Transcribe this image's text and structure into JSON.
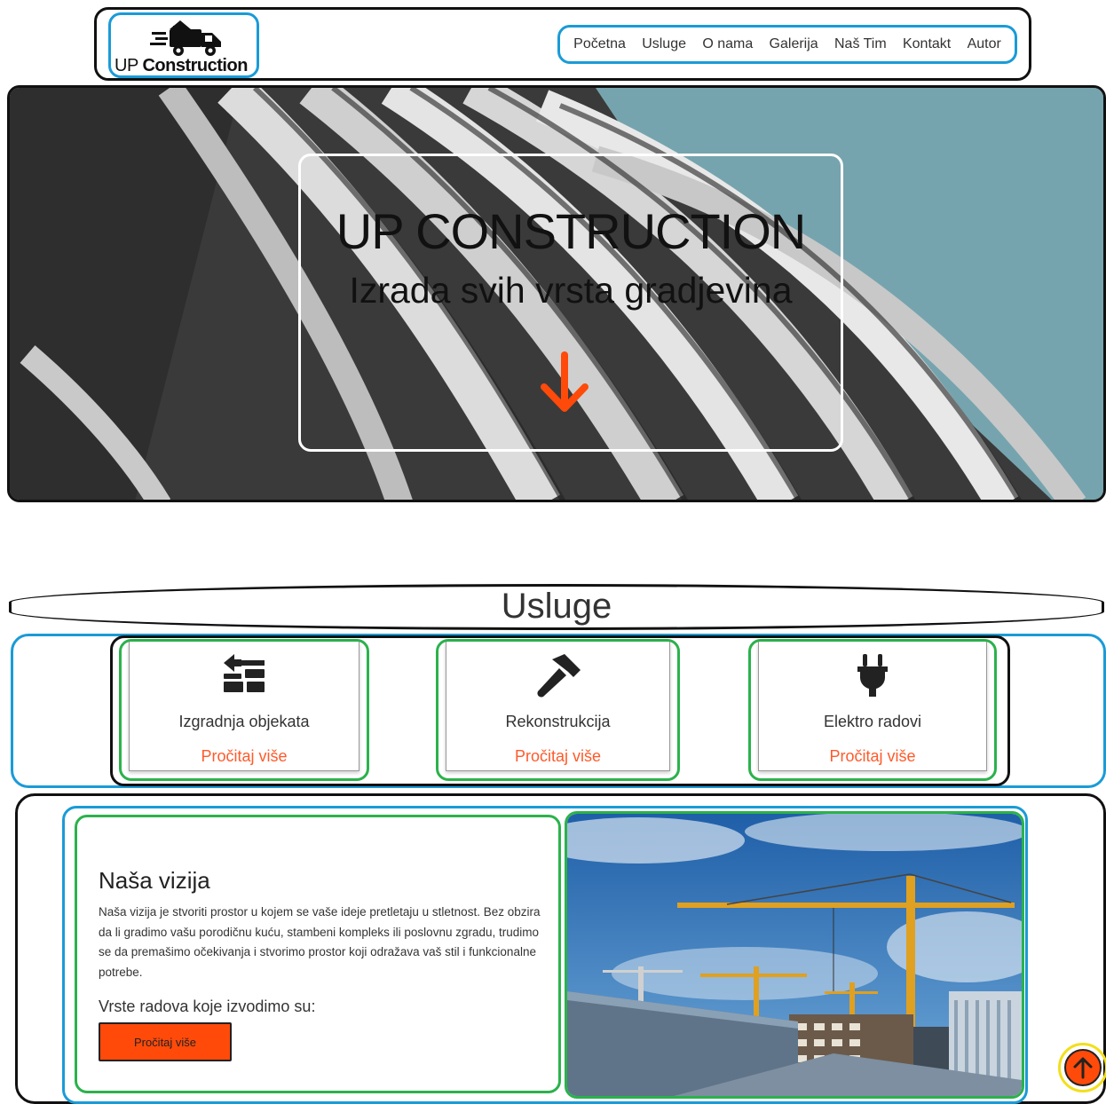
{
  "header": {
    "logo": {
      "text_plain": "UP",
      "text_bold": "Construction",
      "icon": "truck-house-icon"
    },
    "nav": [
      "Početna",
      "Usluge",
      "O nama",
      "Galerija",
      "Naš Tim",
      "Kontakt",
      "Autor"
    ]
  },
  "hero": {
    "title": "UP CONSTRUCTION",
    "subtitle": "Izrada svih vrsta gradjevina",
    "arrow_icon": "arrow-down-icon",
    "arrow_color": "#ff4a0a"
  },
  "services": {
    "title": "Usluge",
    "cards": [
      {
        "icon": "trowel-bricks-icon",
        "title": "Izgradnja objekata",
        "link": "Pročitaj više"
      },
      {
        "icon": "hammer-icon",
        "title": "Rekonstrukcija",
        "link": "Pročitaj više"
      },
      {
        "icon": "plug-icon",
        "title": "Elektro radovi",
        "link": "Pročitaj više"
      }
    ],
    "link_color": "#ff5a2a"
  },
  "vision": {
    "title": "Naša vizija",
    "body": "Naša vizija je stvoriti prostor u kojem se vaše ideje pretletaju u stletnost. Bez obzira da li gradimo vašu porodičnu kuću, stambeni kompleks ili poslovnu zgradu, trudimo se da premašimo očekivanja i stvorimo prostor koji odražava vaš stil i funkcionalne potrebe.",
    "subheading": "Vrste radova koje izvodimo su:",
    "button": "Pročitaj više",
    "image": "construction-cranes-photo"
  },
  "back_to_top": {
    "icon": "arrow-up-icon",
    "color": "#ff4a0a"
  },
  "colors": {
    "accent": "#ff4a0a",
    "outline_blue": "#1a9bd7",
    "outline_green": "#2bb24c"
  }
}
